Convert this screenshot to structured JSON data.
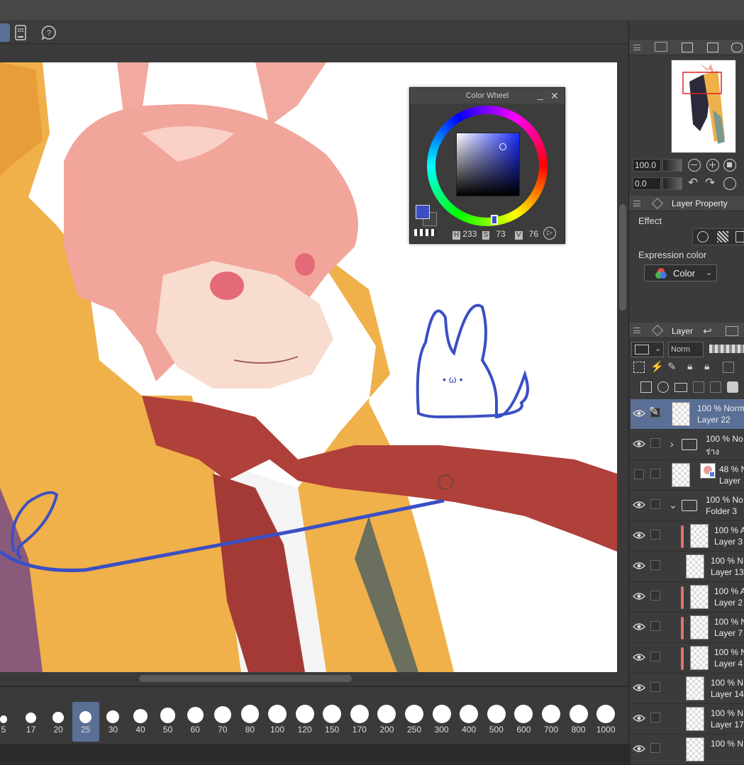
{
  "color_wheel": {
    "title": "Color Wheel",
    "h_label": "H",
    "h_value": "233",
    "s_label": "S",
    "s_value": "73",
    "v_label": "V",
    "v_value": "76",
    "main_color": "#3b4fc4"
  },
  "brush_sizes": [
    "5",
    "17",
    "20",
    "25",
    "30",
    "40",
    "50",
    "60",
    "70",
    "80",
    "100",
    "120",
    "150",
    "170",
    "200",
    "250",
    "300",
    "400",
    "500",
    "600",
    "700",
    "800",
    "1000"
  ],
  "selected_brush_size": "25",
  "navigator": {
    "zoom": "100.0",
    "angle": "0.0"
  },
  "layer_property": {
    "tab_label": "Layer Property",
    "effect_label": "Effect",
    "expression_color_label": "Expression color",
    "expression_color_value": "Color"
  },
  "layer_panel": {
    "tab_label": "Layer",
    "blend_mode": "Norm",
    "layers": [
      {
        "line1": "100 % Norm",
        "line2": "Layer 22",
        "selected": true
      },
      {
        "line1": "100 % No",
        "line2": "ร่าง"
      },
      {
        "line1": "48 % N",
        "line2": "Layer"
      },
      {
        "line1": "100 % No",
        "line2": "Folder 3"
      },
      {
        "line1": "100 % A",
        "line2": "Layer 3"
      },
      {
        "line1": "100 % N",
        "line2": "Layer 13"
      },
      {
        "line1": "100 % A",
        "line2": "Layer 2"
      },
      {
        "line1": "100 % N",
        "line2": "Layer 7"
      },
      {
        "line1": "100 % N",
        "line2": "Layer 4"
      },
      {
        "line1": "100 % N",
        "line2": "Layer 14"
      },
      {
        "line1": "100 % N",
        "line2": "Layer 17"
      },
      {
        "line1": "100 % N",
        "line2": ""
      }
    ]
  }
}
